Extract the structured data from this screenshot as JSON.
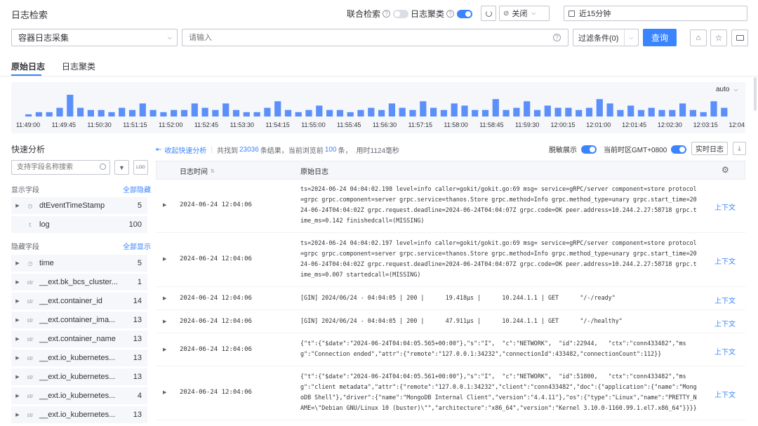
{
  "header": {
    "title": "日志检索",
    "union_search_label": "联合检索",
    "log_cluster_label": "日志聚类",
    "auto_refresh": "关闭",
    "time_range": "近15分钟"
  },
  "search": {
    "index_set": "容器日志采集",
    "placeholder": "请输入",
    "filter_label": "过滤条件(0)",
    "query_button": "查询"
  },
  "tabs": [
    {
      "label": "原始日志",
      "active": true
    },
    {
      "label": "日志聚类",
      "active": false
    }
  ],
  "histogram": {
    "interval": "auto",
    "bar_color": "#5b8ff9",
    "values": [
      1,
      2,
      2,
      4,
      10,
      4,
      3,
      3,
      2,
      4,
      3,
      6,
      3,
      2,
      3,
      3,
      6,
      4,
      3,
      6,
      3,
      2,
      2,
      4,
      7,
      3,
      2,
      3,
      5,
      3,
      3,
      2,
      3,
      4,
      3,
      6,
      4,
      3,
      7,
      4,
      3,
      6,
      5,
      3,
      3,
      8,
      3,
      4,
      7,
      3,
      5,
      4,
      4,
      3,
      4,
      8,
      6,
      3,
      5,
      3,
      4,
      3,
      3,
      6,
      3,
      2,
      7,
      4,
      3,
      6,
      4,
      4,
      2,
      3,
      7,
      4,
      3,
      8,
      4,
      5,
      3,
      2,
      3,
      4,
      3,
      2,
      3,
      3,
      6,
      4,
      3,
      3,
      4,
      3,
      2,
      3,
      3,
      4,
      5,
      2,
      3,
      4,
      3,
      3,
      2,
      5,
      2,
      2,
      3,
      2,
      3,
      2,
      3,
      2,
      3,
      2,
      3,
      3,
      7,
      4,
      3,
      5,
      3,
      2,
      3,
      4,
      2,
      3,
      4,
      3,
      2,
      3,
      4,
      3,
      6,
      3,
      2,
      3,
      4,
      3,
      3,
      3,
      2,
      4,
      2,
      3,
      5,
      3,
      2,
      3,
      2,
      3,
      2,
      4,
      3,
      4,
      3,
      3,
      2,
      3,
      2,
      3,
      2,
      2,
      3,
      4,
      3,
      2,
      3,
      4,
      3,
      3,
      2,
      3,
      3,
      2,
      3,
      3,
      5,
      3,
      4,
      3,
      5,
      3,
      3,
      2,
      3,
      3,
      4,
      3,
      5,
      2,
      3,
      3,
      5,
      3,
      6,
      3,
      2,
      3,
      4,
      3,
      2,
      3,
      2,
      3,
      3,
      4,
      2,
      2,
      3,
      2,
      3,
      2,
      2,
      3,
      3,
      2,
      4,
      3,
      5,
      3,
      2,
      3,
      3,
      2,
      3,
      3,
      2,
      3,
      2,
      4,
      2,
      4,
      3,
      2,
      3,
      3,
      2,
      3,
      5,
      4,
      3,
      2,
      2,
      3,
      6,
      2,
      6,
      3,
      2,
      3,
      3,
      2,
      6,
      3,
      2,
      3,
      3,
      2,
      3,
      3,
      2,
      6,
      3,
      5,
      3,
      3,
      2,
      3,
      4,
      3,
      6,
      3,
      3,
      2,
      5,
      4,
      3,
      3,
      2,
      3,
      3,
      4,
      3,
      4,
      4,
      3,
      3,
      3,
      4,
      5,
      4,
      5,
      3,
      3,
      3,
      6,
      3,
      4,
      2,
      3,
      4,
      3,
      3,
      3,
      5,
      3,
      2,
      2,
      5,
      3,
      4,
      3,
      3,
      2,
      3,
      2,
      3,
      2,
      4,
      3,
      2,
      4,
      2,
      3,
      4,
      3,
      3,
      3,
      3,
      5,
      7,
      3,
      3,
      2,
      3,
      6,
      4,
      4,
      4,
      2,
      3,
      5,
      4,
      3,
      6,
      2,
      3,
      3,
      2,
      3,
      2,
      3,
      2,
      3,
      2,
      4,
      2,
      3,
      4,
      3,
      2,
      5,
      3,
      5,
      3,
      4,
      3,
      3,
      2,
      5,
      3,
      2,
      3,
      4,
      3,
      2,
      3,
      3,
      2,
      4,
      7,
      4,
      3,
      2,
      5,
      3,
      3,
      2,
      2,
      3,
      6,
      3,
      2,
      3,
      2,
      5,
      3,
      2,
      4,
      2,
      3,
      5,
      2,
      3,
      6,
      2,
      3,
      3,
      2,
      3,
      3,
      2,
      5,
      2,
      3,
      2,
      2,
      3,
      3,
      2,
      3,
      4,
      2,
      3,
      4,
      3,
      3,
      2,
      3,
      3,
      3,
      5,
      4,
      3,
      3,
      2,
      3,
      3,
      3,
      5,
      4,
      3,
      5,
      4,
      3,
      3,
      2,
      3,
      4,
      3,
      3,
      4,
      3,
      4,
      2,
      3,
      6,
      3,
      3,
      4,
      5,
      3,
      2,
      3,
      3,
      3,
      3,
      3,
      3,
      2,
      3,
      3,
      4,
      2,
      3,
      3,
      2,
      2,
      3,
      3,
      2,
      3,
      2,
      4,
      3,
      3,
      3,
      3,
      4,
      3,
      4,
      5,
      3,
      4,
      3,
      4,
      3,
      6,
      3,
      5,
      3,
      3,
      3,
      3,
      6,
      4,
      3,
      4,
      3,
      2,
      5,
      3,
      2,
      3,
      3,
      5,
      3,
      3,
      4,
      3,
      4,
      5,
      3,
      3,
      4,
      3,
      3,
      3,
      4,
      3,
      3,
      2,
      4,
      3,
      3,
      2,
      3,
      2,
      2,
      4,
      3,
      4,
      3,
      3,
      2,
      3,
      2,
      3,
      3,
      3,
      2,
      3,
      2,
      3,
      3,
      2,
      6,
      3,
      3,
      2,
      2,
      3,
      3,
      3,
      2,
      3,
      2,
      3,
      3,
      2,
      3,
      2,
      3,
      2,
      3,
      2,
      3,
      4,
      2,
      3,
      3,
      3,
      4,
      3,
      4,
      4,
      3,
      3,
      2,
      3,
      3,
      2,
      3,
      6,
      3,
      3,
      4,
      2,
      3,
      6,
      4,
      2,
      3,
      3,
      2,
      3,
      2,
      3,
      3,
      2,
      3,
      3,
      4,
      3,
      3,
      2,
      4,
      3,
      3,
      4,
      4,
      3,
      3,
      3,
      3,
      2,
      3,
      4,
      3,
      3,
      2,
      3,
      3,
      2,
      2,
      3,
      6,
      3,
      2,
      3,
      5,
      2,
      2,
      3,
      3,
      3,
      2,
      3,
      4,
      3,
      3,
      3,
      2,
      3,
      2,
      3,
      2,
      4,
      3,
      3,
      3,
      5,
      3,
      5,
      2,
      3,
      6,
      2,
      3,
      2,
      2,
      3,
      4,
      3,
      3,
      2,
      3,
      5,
      3,
      2,
      3,
      3,
      2,
      3,
      2,
      2,
      3,
      5,
      3,
      4,
      3,
      3,
      5,
      3,
      3,
      4,
      3,
      6,
      4,
      3,
      3,
      2,
      3,
      2,
      3,
      2,
      6,
      3,
      3,
      2,
      4,
      3,
      2,
      3,
      3,
      5,
      3,
      5,
      4,
      3,
      3,
      2,
      2,
      3,
      3,
      3,
      2,
      3,
      2,
      3,
      2,
      5,
      3,
      3,
      2,
      3,
      4,
      3,
      3,
      2,
      4,
      3,
      3,
      4,
      3,
      4,
      2,
      3,
      2,
      3,
      2,
      3,
      6,
      3,
      2,
      3,
      2,
      3,
      3,
      3,
      4,
      3,
      2,
      3,
      3,
      3,
      5,
      3,
      2,
      3,
      3,
      4,
      3,
      2,
      3,
      3,
      3,
      3,
      4,
      2,
      3,
      5,
      3,
      4,
      3,
      2,
      2,
      3,
      2,
      3,
      3,
      5,
      3,
      3,
      4,
      3,
      2,
      3,
      2,
      3,
      3,
      2,
      3,
      3,
      2,
      3,
      2,
      3,
      2,
      3,
      4,
      3,
      5,
      3,
      4,
      3,
      2,
      5,
      3,
      3,
      3,
      2,
      3,
      4,
      3,
      2,
      3,
      3,
      4,
      2,
      3,
      3,
      3,
      3,
      2,
      3,
      5,
      3,
      3,
      5,
      4,
      4,
      3,
      2,
      3,
      3,
      2,
      3,
      4,
      3,
      2,
      4,
      3,
      2,
      3,
      2,
      3,
      3,
      2,
      3,
      3,
      2,
      3,
      3,
      2,
      3,
      4,
      3,
      3,
      3,
      3,
      2,
      4,
      2,
      3,
      3,
      2,
      3,
      2,
      3,
      3,
      2,
      3,
      3,
      3,
      3,
      3,
      3,
      4,
      3,
      3,
      4,
      3,
      2,
      3,
      3,
      3,
      4,
      3,
      2,
      3,
      2,
      3,
      3,
      3,
      2,
      4,
      3,
      3,
      3,
      4,
      3,
      5,
      3,
      2,
      3,
      4,
      3,
      2,
      5,
      3,
      3,
      3,
      2,
      3,
      2,
      3,
      5,
      3,
      3,
      4,
      3,
      2,
      3,
      2,
      4,
      3,
      3,
      3,
      3,
      2,
      3,
      2,
      3,
      4,
      3,
      5,
      2,
      3,
      3,
      5,
      3,
      3,
      3,
      2,
      3,
      3,
      3,
      3,
      3,
      2,
      3,
      2,
      4,
      2,
      4,
      3,
      6,
      2,
      5,
      3,
      2,
      3,
      6,
      2,
      3,
      4,
      3,
      2,
      4,
      3,
      3,
      2,
      3,
      3,
      3,
      2,
      3,
      6,
      3,
      3,
      4,
      3,
      3,
      2,
      3,
      4,
      3,
      3,
      3,
      3,
      3,
      2,
      3,
      3,
      3,
      2,
      3,
      3,
      3,
      3,
      2,
      3,
      3,
      4,
      2,
      3,
      3,
      3,
      3,
      2,
      2,
      3,
      5,
      3,
      2,
      3,
      2,
      3,
      3,
      2,
      3,
      4,
      2,
      3,
      2,
      2,
      3,
      2,
      3,
      3,
      5,
      2,
      4,
      3,
      3,
      2,
      2,
      3,
      6,
      3,
      3,
      4,
      3,
      4,
      2,
      3,
      3,
      2,
      3,
      3,
      4,
      3,
      3,
      3,
      3,
      3,
      4,
      2,
      3,
      3,
      2,
      3,
      4,
      3,
      2,
      3,
      3,
      2,
      3,
      2,
      3,
      3,
      2,
      3,
      4,
      3,
      3,
      3,
      2,
      3,
      2,
      2,
      5,
      3,
      2,
      3,
      2,
      3,
      4,
      3,
      3,
      3,
      2,
      3,
      3,
      3,
      3,
      4,
      3,
      3,
      4,
      3,
      6,
      3,
      3,
      2,
      3,
      3,
      2,
      3,
      2,
      3,
      2,
      5,
      3,
      3,
      3,
      2,
      3,
      3,
      4,
      3,
      3,
      2,
      4,
      2,
      3,
      2,
      2,
      3,
      3,
      6,
      3,
      3,
      4,
      2,
      2,
      3,
      2,
      3,
      3,
      3,
      2,
      3,
      4,
      3,
      3,
      2,
      3,
      4,
      3,
      3,
      3,
      3,
      4,
      3,
      2,
      3,
      3,
      3,
      3,
      3,
      2,
      3,
      3,
      2,
      2,
      3,
      4,
      3,
      3,
      3,
      4,
      3,
      4,
      3,
      4,
      3,
      6,
      3,
      2,
      3,
      4,
      3,
      3,
      3,
      3,
      3,
      2,
      3,
      4,
      2,
      3,
      3,
      3,
      3,
      3,
      2,
      2,
      5,
      3,
      3,
      3,
      2,
      4,
      2,
      2,
      3,
      3,
      2,
      3,
      3,
      4,
      3,
      3,
      4,
      3,
      2,
      3,
      3,
      3,
      3,
      3,
      2,
      4,
      3,
      4,
      3,
      3,
      3,
      2,
      3,
      3,
      3,
      3,
      2,
      2,
      3,
      6,
      3,
      3,
      2,
      3,
      2,
      2,
      3,
      4,
      3,
      3,
      3,
      3,
      4,
      3,
      3,
      3,
      5,
      3,
      3,
      3,
      4,
      2,
      3,
      3,
      3,
      2,
      3,
      3,
      2,
      2,
      3,
      3,
      2,
      3,
      2,
      3,
      2,
      3,
      3,
      3,
      3,
      2,
      3,
      2,
      3,
      3,
      4,
      3,
      4,
      2,
      3,
      3,
      4,
      3,
      3,
      2,
      3,
      2,
      3,
      2,
      3,
      4,
      3,
      3,
      3,
      4,
      3,
      2,
      3,
      3,
      3,
      2,
      2,
      3,
      3,
      3,
      4,
      3,
      3,
      3,
      4,
      3,
      2,
      3,
      3,
      3,
      3,
      3,
      4,
      3,
      3,
      2,
      2,
      3,
      3,
      2,
      3,
      2,
      3,
      3,
      3,
      2,
      4,
      3,
      3,
      3,
      3,
      3,
      2,
      3,
      3,
      3,
      2,
      3,
      4,
      3,
      3,
      2,
      3,
      3,
      2,
      3,
      3,
      3,
      5,
      3,
      2,
      3,
      3,
      2,
      3,
      3,
      2,
      3,
      3,
      2,
      2,
      3,
      3,
      2,
      2,
      3,
      3,
      2,
      3,
      4,
      3,
      3,
      2,
      3,
      4,
      3,
      2,
      3,
      2,
      3,
      2,
      3,
      3,
      3,
      3,
      2,
      3,
      3,
      3,
      2,
      3,
      3,
      3,
      4,
      3,
      3,
      3,
      3,
      3,
      2,
      3,
      3,
      2,
      3,
      3,
      2,
      3,
      4,
      3,
      3,
      2,
      3,
      3,
      2,
      3,
      3,
      3,
      3,
      3,
      3,
      2,
      3,
      2,
      3,
      3,
      2,
      3,
      3,
      3,
      3,
      3,
      3,
      2,
      3,
      3,
      3,
      2,
      3,
      3,
      3,
      2,
      3,
      2,
      3,
      3,
      3,
      3,
      2,
      3,
      3,
      2,
      3,
      3,
      3,
      3,
      2,
      3,
      3,
      2,
      3,
      3,
      3,
      3,
      3,
      2,
      3,
      3,
      3,
      2,
      3,
      3,
      3,
      3,
      3,
      2,
      3,
      3,
      2,
      3,
      3,
      3,
      3,
      2,
      3,
      3,
      3,
      3,
      3,
      3,
      2,
      3,
      3,
      3,
      2,
      3,
      3,
      2,
      3,
      3,
      3,
      3,
      3,
      3,
      2,
      3,
      3,
      3,
      3,
      2,
      3,
      3
    ],
    "ticks": [
      "11:49:00",
      "11:49:45",
      "11:50:30",
      "11:51:15",
      "11:52:00",
      "11:52:45",
      "11:53:30",
      "11:54:15",
      "11:55:00",
      "11:55:45",
      "11:56:30",
      "11:57:15",
      "11:58:00",
      "11:58:45",
      "11:59:30",
      "12:00:15",
      "12:01:00",
      "12:01:45",
      "12:02:30",
      "12:03:15",
      "12:04:00"
    ]
  },
  "sidebar": {
    "title": "快速分析",
    "search_placeholder": "支持字段名称搜索",
    "log_button": "LOG",
    "visible_section": "显示字段",
    "hide_all": "全部隐藏",
    "hidden_section": "隐藏字段",
    "show_all": "全部显示",
    "visible_fields": [
      {
        "type": "clock",
        "name": "dtEventTimeStamp",
        "count": "5",
        "expandable": true
      },
      {
        "type": "t",
        "name": "log",
        "count": "100",
        "expandable": false
      }
    ],
    "hidden_fields": [
      {
        "type": "clock",
        "name": "time",
        "count": "5"
      },
      {
        "type": "str",
        "name": "__ext.bk_bcs_cluster...",
        "count": "1"
      },
      {
        "type": "str",
        "name": "__ext.container_id",
        "count": "14"
      },
      {
        "type": "str",
        "name": "__ext.container_ima...",
        "count": "13"
      },
      {
        "type": "str",
        "name": "__ext.container_name",
        "count": "13"
      },
      {
        "type": "str",
        "name": "__ext.io_kubernetes...",
        "count": "13"
      },
      {
        "type": "str",
        "name": "__ext.io_kubernetes...",
        "count": "13"
      },
      {
        "type": "str",
        "name": "__ext.io_kubernetes...",
        "count": "4"
      },
      {
        "type": "str",
        "name": "__ext.io_kubernetes...",
        "count": "13"
      }
    ]
  },
  "results": {
    "collapse_label": "收起快速分析",
    "summary_prefix": "共找到",
    "total": "23036",
    "summary_mid": "条结果，当前浏览前",
    "shown": "100",
    "summary_mid2": "条，",
    "elapsed": "用时1124毫秒",
    "mask_label": "脱敏展示",
    "timezone_label": "当前时区GMT+0800",
    "realtime_button": "实时日志",
    "col_time": "日志时间",
    "col_log": "原始日志",
    "context_label": "上下文"
  },
  "log_rows": [
    {
      "time": "2024-06-24 12:04:06",
      "text": "ts=2024-06-24 04:04:02.198 level=info caller=gokit/gokit.go:69 msg= service=gRPC/server component=store protocol=grpc grpc.component=server grpc.service=thanos.Store grpc.method=Info grpc.method_type=unary grpc.start_time=2024-06-24T04:04:02Z grpc.request.deadline=2024-06-24T04:04:07Z grpc.code=OK peer.address=10.244.2.27:58718 grpc.time_ms=0.142 finishedcall=(MISSING)"
    },
    {
      "time": "2024-06-24 12:04:06",
      "text": "ts=2024-06-24 04:04:02.197 level=info caller=gokit/gokit.go:69 msg= service=gRPC/server component=store protocol=grpc grpc.component=server grpc.service=thanos.Store grpc.method=Info grpc.method_type=unary grpc.start_time=2024-06-24T04:04:02Z grpc.request.deadline=2024-06-24T04:04:07Z grpc.code=OK peer.address=10.244.2.27:58718 grpc.time_ms=0.007 startedcall=(MISSING)"
    },
    {
      "time": "2024-06-24 12:04:06",
      "text": "[GIN] 2024/06/24 - 04:04:05 | 200 |      19.418µs |      10.244.1.1 | GET      \"/-/ready\""
    },
    {
      "time": "2024-06-24 12:04:06",
      "text": "[GIN] 2024/06/24 - 04:04:05 | 200 |      47.911µs |      10.244.1.1 | GET      \"/-/healthy\""
    },
    {
      "time": "2024-06-24 12:04:06",
      "text": "{\"t\":{\"$date\":\"2024-06-24T04:04:05.565+00:00\"},\"s\":\"I\",  \"c\":\"NETWORK\",  \"id\":22944,   \"ctx\":\"conn433482\",\"msg\":\"Connection ended\",\"attr\":{\"remote\":\"127.0.0.1:34232\",\"connectionId\":433482,\"connectionCount\":112}}"
    },
    {
      "time": "2024-06-24 12:04:06",
      "text": "{\"t\":{\"$date\":\"2024-06-24T04:04:05.561+00:00\"},\"s\":\"I\",  \"c\":\"NETWORK\",  \"id\":51800,   \"ctx\":\"conn433482\",\"msg\":\"client metadata\",\"attr\":{\"remote\":\"127.0.0.1:34232\",\"client\":\"conn433482\",\"doc\":{\"application\":{\"name\":\"MongoDB Shell\"},\"driver\":{\"name\":\"MongoDB Internal Client\",\"version\":\"4.4.11\"},\"os\":{\"type\":\"Linux\",\"name\":\"PRETTY_NAME=\\\"Debian GNU/Linux 10 (buster)\\\"\",\"architecture\":\"x86_64\",\"version\":\"Kernel 3.10.0-1160.99.1.el7.x86_64\"}}}}"
    }
  ]
}
